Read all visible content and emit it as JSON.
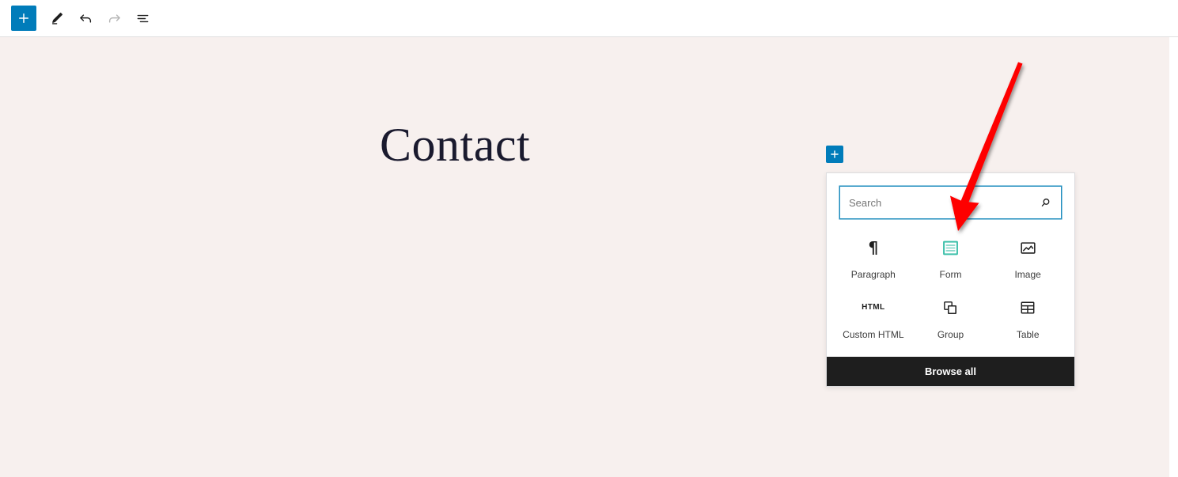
{
  "toolbar": {
    "add_block_label": "+",
    "buttons": [
      {
        "name": "toggle-block-inserter-button",
        "icon": "plus-icon",
        "title": "Toggle block inserter",
        "state": "active"
      },
      {
        "name": "edit-tool-button",
        "icon": "pencil-icon",
        "title": "Edit",
        "state": "default"
      },
      {
        "name": "undo-button",
        "icon": "undo-arrow-icon",
        "title": "Undo",
        "state": "default"
      },
      {
        "name": "redo-button",
        "icon": "redo-arrow-icon",
        "title": "Redo",
        "state": "disabled"
      },
      {
        "name": "document-overview-button",
        "icon": "list-view-icon",
        "title": "Document Overview",
        "state": "default"
      }
    ]
  },
  "canvas": {
    "page_title": "Contact",
    "background_color": "#f7f0ee"
  },
  "inserter_toggle": {
    "label": "+",
    "icon": "plus-icon",
    "background_color": "#007cba"
  },
  "quick_inserter": {
    "search": {
      "placeholder": "Search",
      "value": "",
      "icon": "search-icon",
      "focus_border_color": "#1e8cbe"
    },
    "blocks": [
      {
        "label": "Paragraph",
        "icon": "paragraph-icon",
        "name": "paragraph"
      },
      {
        "label": "Form",
        "icon": "form-icon",
        "name": "form",
        "icon_color": "#3fc1ab"
      },
      {
        "label": "Image",
        "icon": "image-icon",
        "name": "image"
      },
      {
        "label": "Custom HTML",
        "icon": "custom-html-icon",
        "name": "custom-html",
        "icon_text": "HTML"
      },
      {
        "label": "Group",
        "icon": "group-icon",
        "name": "group"
      },
      {
        "label": "Table",
        "icon": "table-icon",
        "name": "table"
      }
    ],
    "browse_all_label": "Browse all",
    "browse_all_background": "#1e1e1e"
  },
  "annotation": {
    "arrow_color": "#fe0000",
    "points_to": "Form"
  }
}
